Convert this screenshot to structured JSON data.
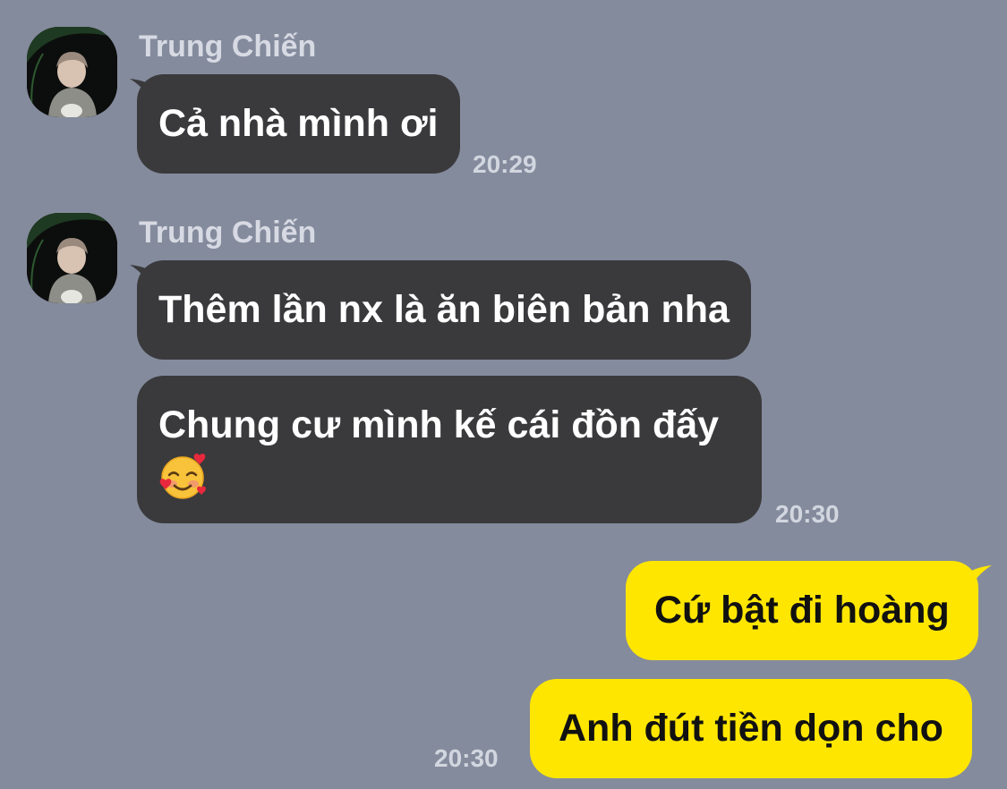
{
  "chat": {
    "messages": [
      {
        "sender": "Trung Chiến",
        "text": "Cả nhà mình ơi",
        "time": "20:29"
      },
      {
        "sender": "Trung Chiến",
        "text": "Thêm lần nx là ăn biên bản nha"
      },
      {
        "text": "Chung cư mình kế cái đồn đấy",
        "emoji": "smiling-face-with-hearts-emoji",
        "time": "20:30"
      },
      {
        "text": "Cứ bật đi hoàng",
        "outgoing": true
      },
      {
        "text": "Anh đút tiền dọn cho",
        "outgoing": true,
        "time": "20:30"
      }
    ]
  },
  "colors": {
    "background": "#848b9d",
    "incoming_bubble": "#3a3a3c",
    "outgoing_bubble": "#ffe600"
  }
}
